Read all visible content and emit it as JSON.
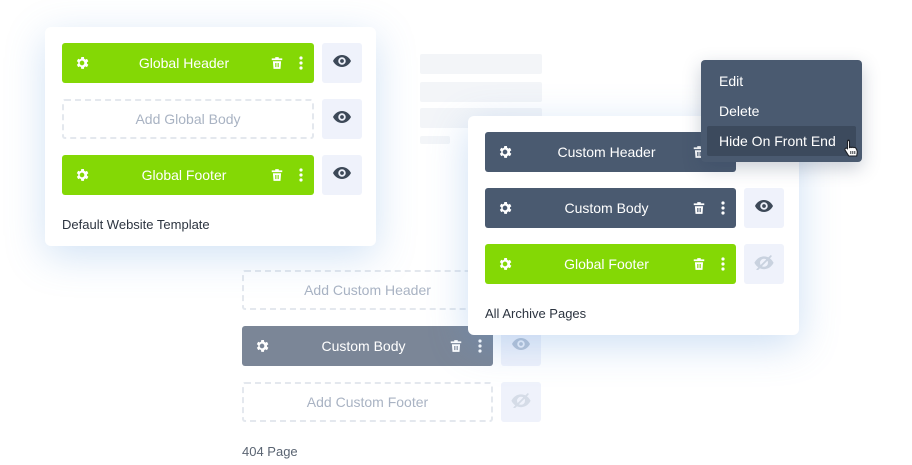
{
  "default_template": {
    "header_label": "Global Header",
    "body_placeholder": "Add Global Body",
    "footer_label": "Global Footer",
    "title": "Default Website Template"
  },
  "page_404": {
    "header_placeholder": "Add Custom Header",
    "body_label": "Custom Body",
    "footer_placeholder": "Add Custom Footer",
    "title": "404 Page"
  },
  "archive_template": {
    "header_label": "Custom Header",
    "body_label": "Custom Body",
    "footer_label": "Global Footer",
    "title": "All Archive Pages"
  },
  "context_menu": {
    "items": [
      "Edit",
      "Delete",
      "Hide On Front End"
    ],
    "hovered_index": 2
  },
  "colors": {
    "green": "#84d805",
    "slate": "#4a5a70",
    "grey": "#7b8697",
    "eye_bg": "#eff2fb",
    "placeholder_text": "#a9b3c3"
  },
  "icons": [
    "gear-icon",
    "trash-icon",
    "more-vertical-icon",
    "eye-icon",
    "eye-off-icon",
    "hand-pointer-cursor"
  ]
}
